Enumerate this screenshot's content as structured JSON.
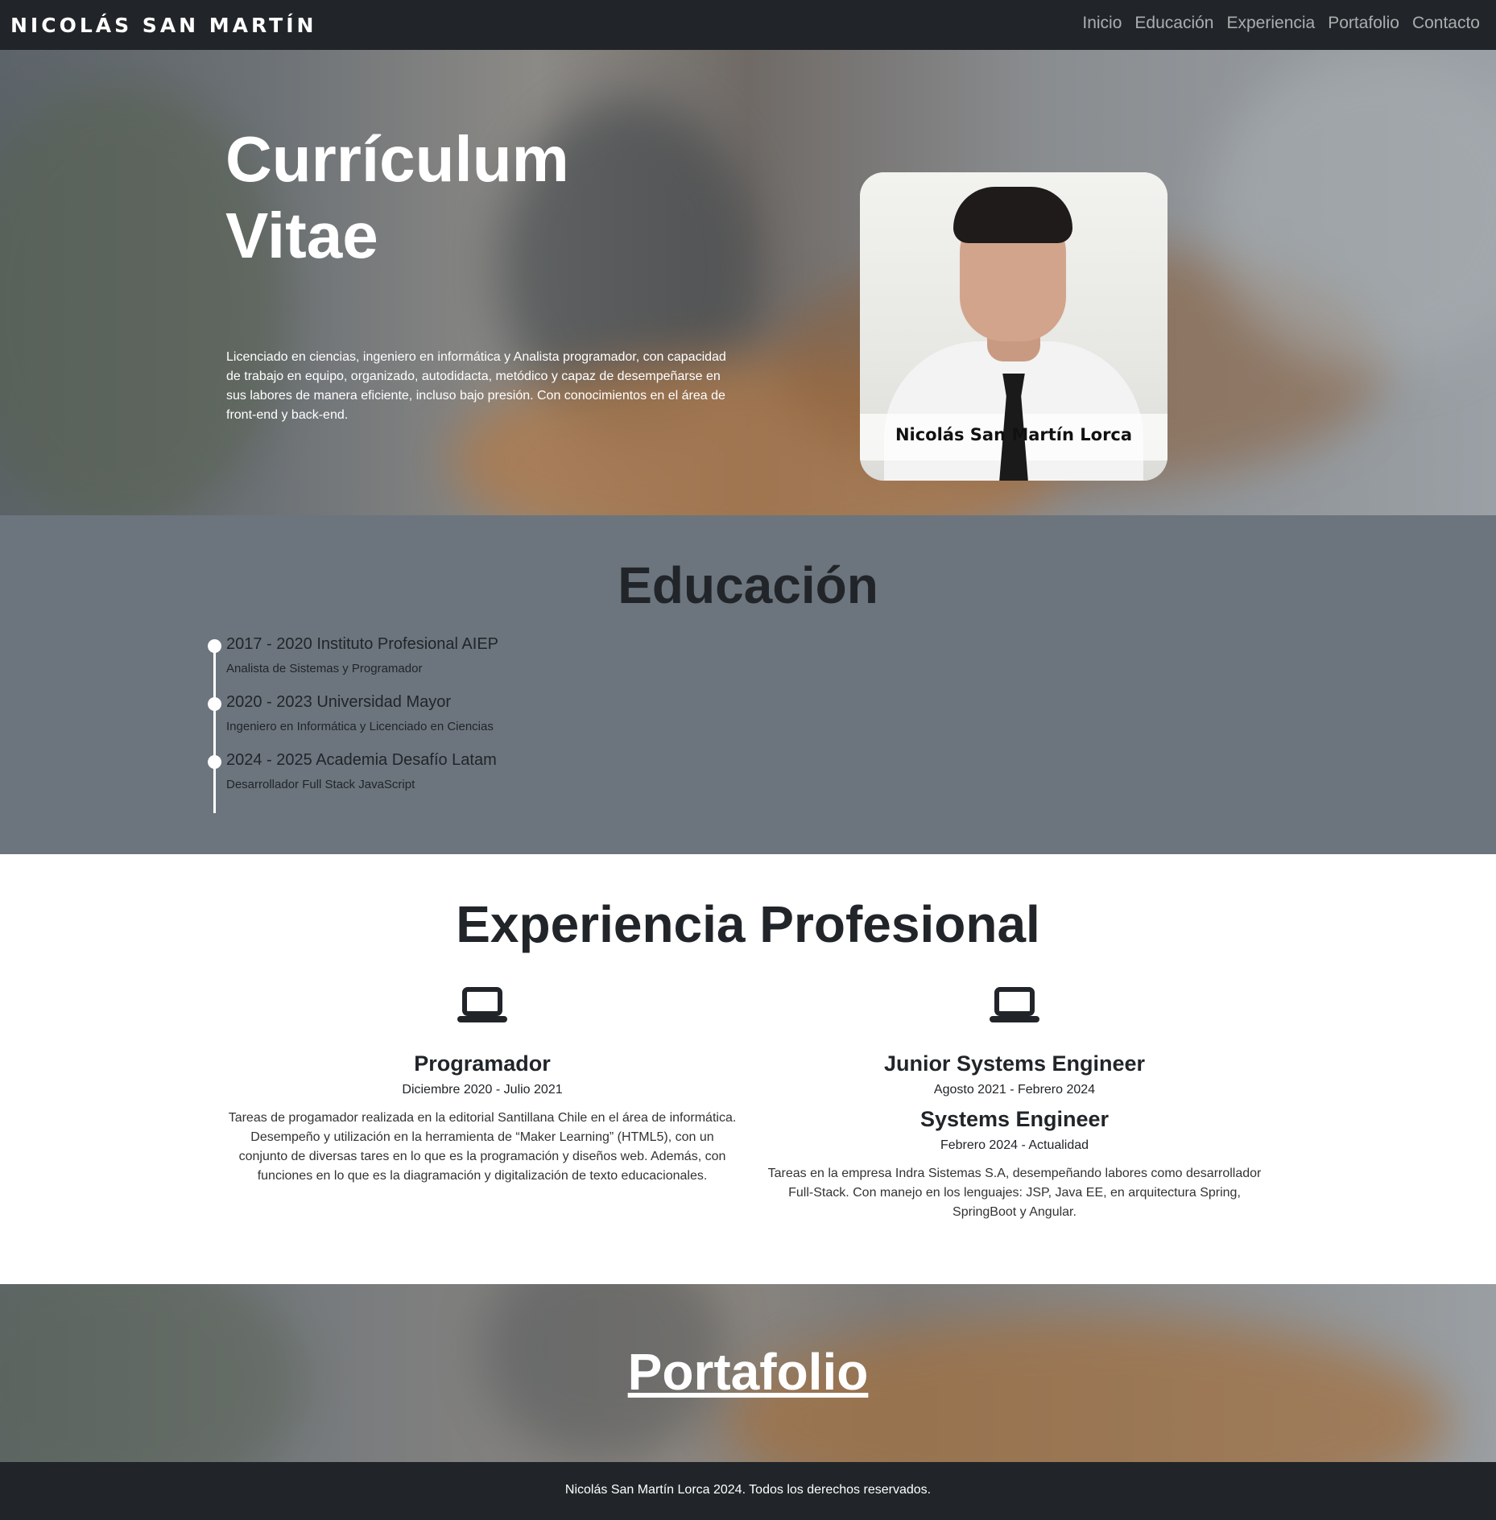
{
  "navbar": {
    "brand": "NICOLÁS SAN MARTÍN",
    "links": [
      "Inicio",
      "Educación",
      "Experiencia",
      "Portafolio",
      "Contacto"
    ]
  },
  "hero": {
    "title_line1": "Currículum",
    "title_line2": "Vitae",
    "description": "Licenciado en ciencias, ingeniero en informática y Analista programador, con capacidad de trabajo en equipo, organizado, autodidacta, metódico y capaz de desempeñarse en sus labores de manera eficiente, incluso bajo presión. Con conocimientos en el área de front-end y back-end.",
    "photo_caption": "Nicolás San Martín Lorca"
  },
  "education": {
    "title": "Educación",
    "items": [
      {
        "heading": "2017 - 2020 Instituto Profesional AIEP",
        "detail": "Analista de Sistemas y Programador"
      },
      {
        "heading": "2020 - 2023 Universidad Mayor",
        "detail": "Ingeniero en Informática y Licenciado en Ciencias"
      },
      {
        "heading": "2024 - 2025 Academia Desafío Latam",
        "detail": "Desarrollador Full Stack JavaScript"
      }
    ]
  },
  "experience": {
    "title": "Experiencia Profesional",
    "icon": "laptop-icon",
    "left": {
      "role": "Programador",
      "date": "Diciembre 2020 - Julio 2021",
      "description": "Tareas de progamador realizada en la editorial Santillana Chile en el área de informática. Desempeño y utilización en la herramienta de “Maker Learning” (HTML5), con un conjunto de diversas tares en lo que es la programación y diseños web. Además, con funciones en lo que es la diagramación y digitalización de texto educacionales."
    },
    "right": {
      "role": "Junior Systems Engineer",
      "date": "Agosto 2021 - Febrero 2024",
      "role2": "Systems Engineer",
      "date2": "Febrero 2024 - Actualidad",
      "description": "Tareas en la empresa Indra Sistemas S.A, desempeñando labores como desarrollador Full-Stack. Con manejo en los lenguajes: JSP, Java EE, en arquitectura Spring, SpringBoot y Angular."
    }
  },
  "portfolio": {
    "title": "Portafolio"
  },
  "footer": {
    "text": "Nicolás San Martín Lorca 2024. Todos los derechos reservados."
  },
  "colors": {
    "navbar": "#212529",
    "education_bg": "#6c757d",
    "text_dark": "#212529",
    "white": "#ffffff"
  }
}
